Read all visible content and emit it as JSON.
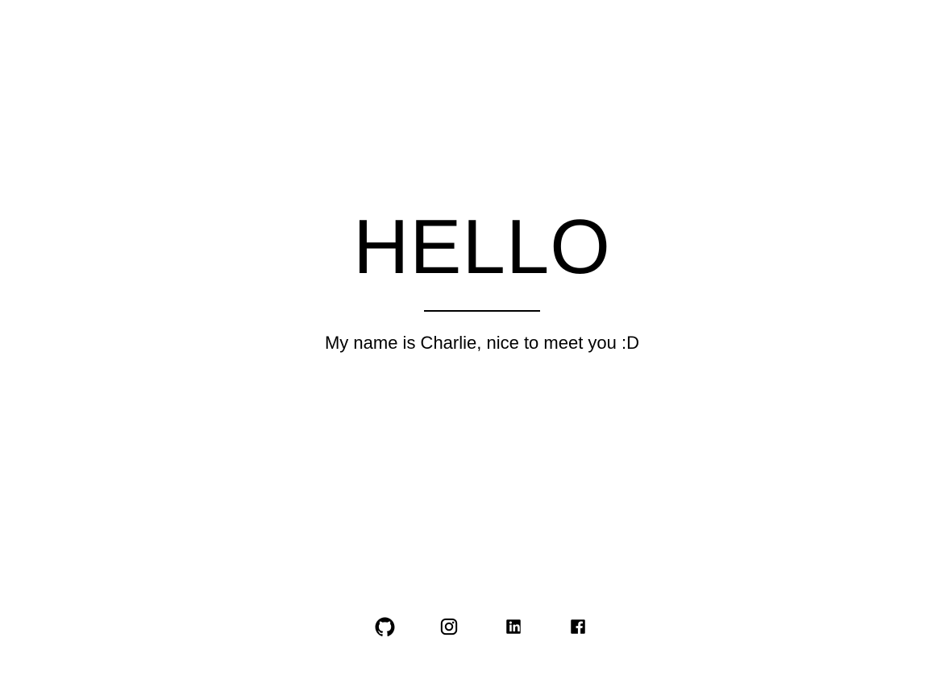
{
  "hero": {
    "title": "HELLO",
    "subtitle": "My name is Charlie, nice to meet you :D"
  },
  "social": {
    "links": [
      {
        "icon": "github-icon",
        "label": "GitHub"
      },
      {
        "icon": "instagram-icon",
        "label": "Instagram"
      },
      {
        "icon": "linkedin-icon",
        "label": "LinkedIn"
      },
      {
        "icon": "facebook-icon",
        "label": "Facebook"
      }
    ]
  },
  "colors": {
    "background": "#ffffff",
    "text": "#000000"
  }
}
